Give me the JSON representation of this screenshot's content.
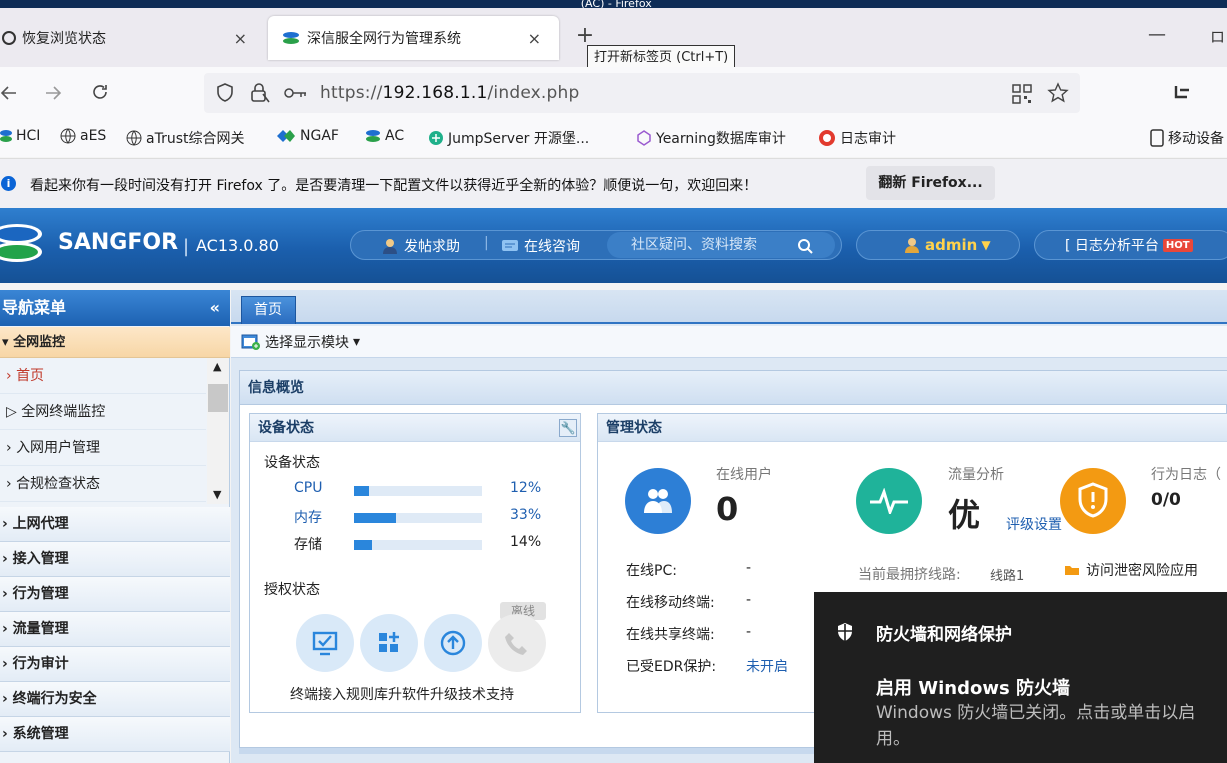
{
  "browser": {
    "titlebar_text": "_(AC) - Firefox",
    "tabs": [
      {
        "label": "恢复浏览状态",
        "close": "×"
      },
      {
        "label": "深信服全网行为管理系统",
        "close": "×"
      }
    ],
    "new_tab_glyph": "+",
    "tooltip": "打开新标签页 (Ctrl+T)",
    "window_min": "—",
    "window_restore": "ロ",
    "url_prefix": "https://",
    "url_host": "192.168.1.1",
    "url_path": "/index.php",
    "bookmarks": [
      "HCI",
      "aES",
      "aTrust综合网关",
      "NGAF",
      "AC",
      "JumpServer 开源堡...",
      "Yearning数据库审计",
      "日志审计"
    ],
    "mobile_bookmarks": "移动设备",
    "notification": "看起来你有一段时间没有打开 Firefox 了。是否要清理一下配置文件以获得近乎全新的体验？顺便说一句，欢迎回来！",
    "refresh_button": "翻新 Firefox..."
  },
  "header": {
    "brand": "SANGFOR",
    "separator": "|",
    "version": "AC13.0.80",
    "help_link": "发帖求助",
    "divider": "|",
    "consult_link": "在线咨询",
    "search_placeholder": "社区疑问、资料搜索",
    "user": "admin",
    "user_caret": "▼",
    "log_platform": "[ 日志分析平台",
    "hot_badge": "HOT"
  },
  "sidebar": {
    "title": "导航菜单",
    "collapse": "«",
    "group_open": "全网监控",
    "items": [
      "首页",
      "全网终端监控",
      "入网用户管理",
      "合规检查状态"
    ],
    "groups": [
      "上网代理",
      "接入管理",
      "行为管理",
      "流量管理",
      "行为审计",
      "终端行为安全",
      "系统管理"
    ]
  },
  "content": {
    "tab": "首页",
    "toolbar_select": "选择显示模块",
    "toolbar_caret": "▾",
    "info_title": "信息概览",
    "device": {
      "title": "设备状态",
      "section": "设备状态",
      "resources": [
        {
          "name": "CPU",
          "percent": 12,
          "label": "12%"
        },
        {
          "name": "内存",
          "percent": 33,
          "label": "33%"
        },
        {
          "name": "存储",
          "percent": 14,
          "label": "14%"
        }
      ],
      "license_title": "授权状态",
      "offline_badge": "离线",
      "license_items": [
        "终端接入",
        "规则库升",
        "软件升级",
        "技术支持"
      ]
    },
    "mgmt": {
      "title": "管理状态",
      "online_users_label": "在线用户",
      "online_users_value": "0",
      "traffic_label": "流量分析",
      "traffic_value": "优",
      "traffic_link": "评级设置",
      "behavior_log_label": "行为日志（",
      "behavior_log_value": "0/0",
      "rows": [
        {
          "label": "在线PC:",
          "value": "-"
        },
        {
          "label": "在线移动终端:",
          "value": "-"
        },
        {
          "label": "在线共享终端:",
          "value": "-"
        },
        {
          "label": "已受EDR保护:",
          "value": "未开启"
        }
      ],
      "congested_label": "当前最拥挤线路:",
      "congested_value": "线路1",
      "leak_risk": "访问泄密风险应用"
    }
  },
  "toast": {
    "title": "防火墙和网络保护",
    "heading": "启用 Windows 防火墙",
    "body": "Windows 防火墙已关闭。点击或单击以启用。"
  }
}
